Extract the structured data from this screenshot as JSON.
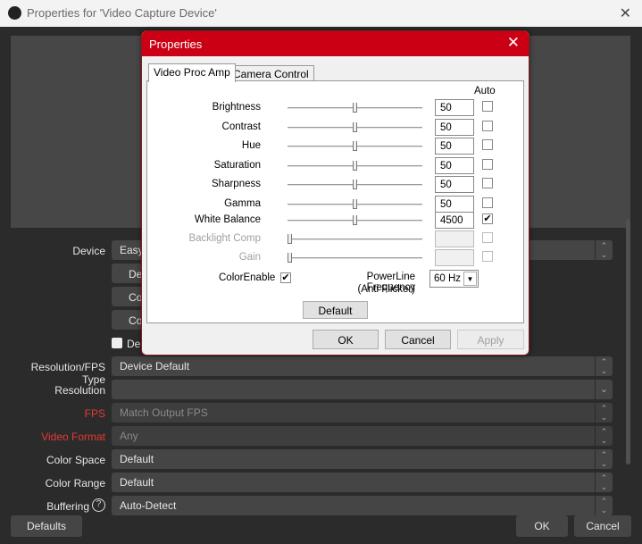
{
  "window": {
    "title": "Properties for 'Video Capture Device'",
    "close": "✕"
  },
  "bg": {
    "device_label": "Device",
    "device_value": "Easy",
    "buttons": [
      "De",
      "Co",
      "Co"
    ],
    "checkbox_label": "Dea",
    "rows": [
      {
        "label": "Resolution/FPS Type",
        "value": "Device Default",
        "red": false,
        "disabled": false,
        "control": "spin"
      },
      {
        "label": "Resolution",
        "value": "",
        "red": false,
        "disabled": false,
        "control": "dropdown"
      },
      {
        "label": "FPS",
        "value": "Match Output FPS",
        "red": true,
        "disabled": true,
        "control": "spin"
      },
      {
        "label": "Video Format",
        "value": "Any",
        "red": true,
        "disabled": true,
        "control": "spin"
      },
      {
        "label": "Color Space",
        "value": "Default",
        "red": false,
        "disabled": false,
        "control": "spin"
      },
      {
        "label": "Color Range",
        "value": "Default",
        "red": false,
        "disabled": false,
        "control": "spin"
      },
      {
        "label": "Buffering",
        "value": "Auto-Detect",
        "red": false,
        "disabled": false,
        "control": "spin"
      }
    ],
    "help": "?",
    "defaults": "Defaults",
    "ok": "OK",
    "cancel": "Cancel"
  },
  "dialog": {
    "title": "Properties",
    "close": "✕",
    "tabs": [
      {
        "label": "Video Proc Amp",
        "active": true
      },
      {
        "label": "Camera Control",
        "active": false
      }
    ],
    "auto_header": "Auto",
    "props": [
      {
        "label": "Brightness",
        "value": "50",
        "level": 0.5,
        "auto": false,
        "enabled": true
      },
      {
        "label": "Contrast",
        "value": "50",
        "level": 0.5,
        "auto": false,
        "enabled": true
      },
      {
        "label": "Hue",
        "value": "50",
        "level": 0.5,
        "auto": false,
        "enabled": true
      },
      {
        "label": "Saturation",
        "value": "50",
        "level": 0.5,
        "auto": false,
        "enabled": true
      },
      {
        "label": "Sharpness",
        "value": "50",
        "level": 0.5,
        "auto": false,
        "enabled": true
      },
      {
        "label": "Gamma",
        "value": "50",
        "level": 0.5,
        "auto": false,
        "enabled": true
      },
      {
        "label": "White Balance",
        "value": "4500",
        "level": 0.5,
        "auto": true,
        "enabled": true
      },
      {
        "label": "Backlight Comp",
        "value": "",
        "level": 0,
        "auto": false,
        "enabled": false
      },
      {
        "label": "Gain",
        "value": "",
        "level": 0,
        "auto": false,
        "enabled": false
      }
    ],
    "color_enable": {
      "label": "ColorEnable",
      "checked": true
    },
    "powerline": {
      "label1": "PowerLine Frequency",
      "label2": "(Anti Flicker)",
      "value": "60 Hz"
    },
    "default": "Default",
    "ok": "OK",
    "cancel": "Cancel",
    "apply": "Apply",
    "accent": "#cc0014"
  }
}
